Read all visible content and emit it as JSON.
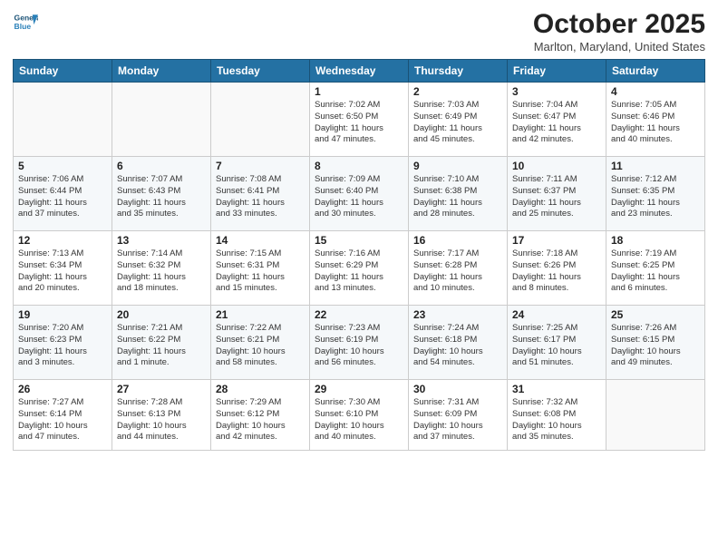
{
  "header": {
    "logo_line1": "General",
    "logo_line2": "Blue",
    "month": "October 2025",
    "location": "Marlton, Maryland, United States"
  },
  "weekdays": [
    "Sunday",
    "Monday",
    "Tuesday",
    "Wednesday",
    "Thursday",
    "Friday",
    "Saturday"
  ],
  "weeks": [
    [
      {
        "day": "",
        "info": ""
      },
      {
        "day": "",
        "info": ""
      },
      {
        "day": "",
        "info": ""
      },
      {
        "day": "1",
        "info": "Sunrise: 7:02 AM\nSunset: 6:50 PM\nDaylight: 11 hours\nand 47 minutes."
      },
      {
        "day": "2",
        "info": "Sunrise: 7:03 AM\nSunset: 6:49 PM\nDaylight: 11 hours\nand 45 minutes."
      },
      {
        "day": "3",
        "info": "Sunrise: 7:04 AM\nSunset: 6:47 PM\nDaylight: 11 hours\nand 42 minutes."
      },
      {
        "day": "4",
        "info": "Sunrise: 7:05 AM\nSunset: 6:46 PM\nDaylight: 11 hours\nand 40 minutes."
      }
    ],
    [
      {
        "day": "5",
        "info": "Sunrise: 7:06 AM\nSunset: 6:44 PM\nDaylight: 11 hours\nand 37 minutes."
      },
      {
        "day": "6",
        "info": "Sunrise: 7:07 AM\nSunset: 6:43 PM\nDaylight: 11 hours\nand 35 minutes."
      },
      {
        "day": "7",
        "info": "Sunrise: 7:08 AM\nSunset: 6:41 PM\nDaylight: 11 hours\nand 33 minutes."
      },
      {
        "day": "8",
        "info": "Sunrise: 7:09 AM\nSunset: 6:40 PM\nDaylight: 11 hours\nand 30 minutes."
      },
      {
        "day": "9",
        "info": "Sunrise: 7:10 AM\nSunset: 6:38 PM\nDaylight: 11 hours\nand 28 minutes."
      },
      {
        "day": "10",
        "info": "Sunrise: 7:11 AM\nSunset: 6:37 PM\nDaylight: 11 hours\nand 25 minutes."
      },
      {
        "day": "11",
        "info": "Sunrise: 7:12 AM\nSunset: 6:35 PM\nDaylight: 11 hours\nand 23 minutes."
      }
    ],
    [
      {
        "day": "12",
        "info": "Sunrise: 7:13 AM\nSunset: 6:34 PM\nDaylight: 11 hours\nand 20 minutes."
      },
      {
        "day": "13",
        "info": "Sunrise: 7:14 AM\nSunset: 6:32 PM\nDaylight: 11 hours\nand 18 minutes."
      },
      {
        "day": "14",
        "info": "Sunrise: 7:15 AM\nSunset: 6:31 PM\nDaylight: 11 hours\nand 15 minutes."
      },
      {
        "day": "15",
        "info": "Sunrise: 7:16 AM\nSunset: 6:29 PM\nDaylight: 11 hours\nand 13 minutes."
      },
      {
        "day": "16",
        "info": "Sunrise: 7:17 AM\nSunset: 6:28 PM\nDaylight: 11 hours\nand 10 minutes."
      },
      {
        "day": "17",
        "info": "Sunrise: 7:18 AM\nSunset: 6:26 PM\nDaylight: 11 hours\nand 8 minutes."
      },
      {
        "day": "18",
        "info": "Sunrise: 7:19 AM\nSunset: 6:25 PM\nDaylight: 11 hours\nand 6 minutes."
      }
    ],
    [
      {
        "day": "19",
        "info": "Sunrise: 7:20 AM\nSunset: 6:23 PM\nDaylight: 11 hours\nand 3 minutes."
      },
      {
        "day": "20",
        "info": "Sunrise: 7:21 AM\nSunset: 6:22 PM\nDaylight: 11 hours\nand 1 minute."
      },
      {
        "day": "21",
        "info": "Sunrise: 7:22 AM\nSunset: 6:21 PM\nDaylight: 10 hours\nand 58 minutes."
      },
      {
        "day": "22",
        "info": "Sunrise: 7:23 AM\nSunset: 6:19 PM\nDaylight: 10 hours\nand 56 minutes."
      },
      {
        "day": "23",
        "info": "Sunrise: 7:24 AM\nSunset: 6:18 PM\nDaylight: 10 hours\nand 54 minutes."
      },
      {
        "day": "24",
        "info": "Sunrise: 7:25 AM\nSunset: 6:17 PM\nDaylight: 10 hours\nand 51 minutes."
      },
      {
        "day": "25",
        "info": "Sunrise: 7:26 AM\nSunset: 6:15 PM\nDaylight: 10 hours\nand 49 minutes."
      }
    ],
    [
      {
        "day": "26",
        "info": "Sunrise: 7:27 AM\nSunset: 6:14 PM\nDaylight: 10 hours\nand 47 minutes."
      },
      {
        "day": "27",
        "info": "Sunrise: 7:28 AM\nSunset: 6:13 PM\nDaylight: 10 hours\nand 44 minutes."
      },
      {
        "day": "28",
        "info": "Sunrise: 7:29 AM\nSunset: 6:12 PM\nDaylight: 10 hours\nand 42 minutes."
      },
      {
        "day": "29",
        "info": "Sunrise: 7:30 AM\nSunset: 6:10 PM\nDaylight: 10 hours\nand 40 minutes."
      },
      {
        "day": "30",
        "info": "Sunrise: 7:31 AM\nSunset: 6:09 PM\nDaylight: 10 hours\nand 37 minutes."
      },
      {
        "day": "31",
        "info": "Sunrise: 7:32 AM\nSunset: 6:08 PM\nDaylight: 10 hours\nand 35 minutes."
      },
      {
        "day": "",
        "info": ""
      }
    ]
  ]
}
